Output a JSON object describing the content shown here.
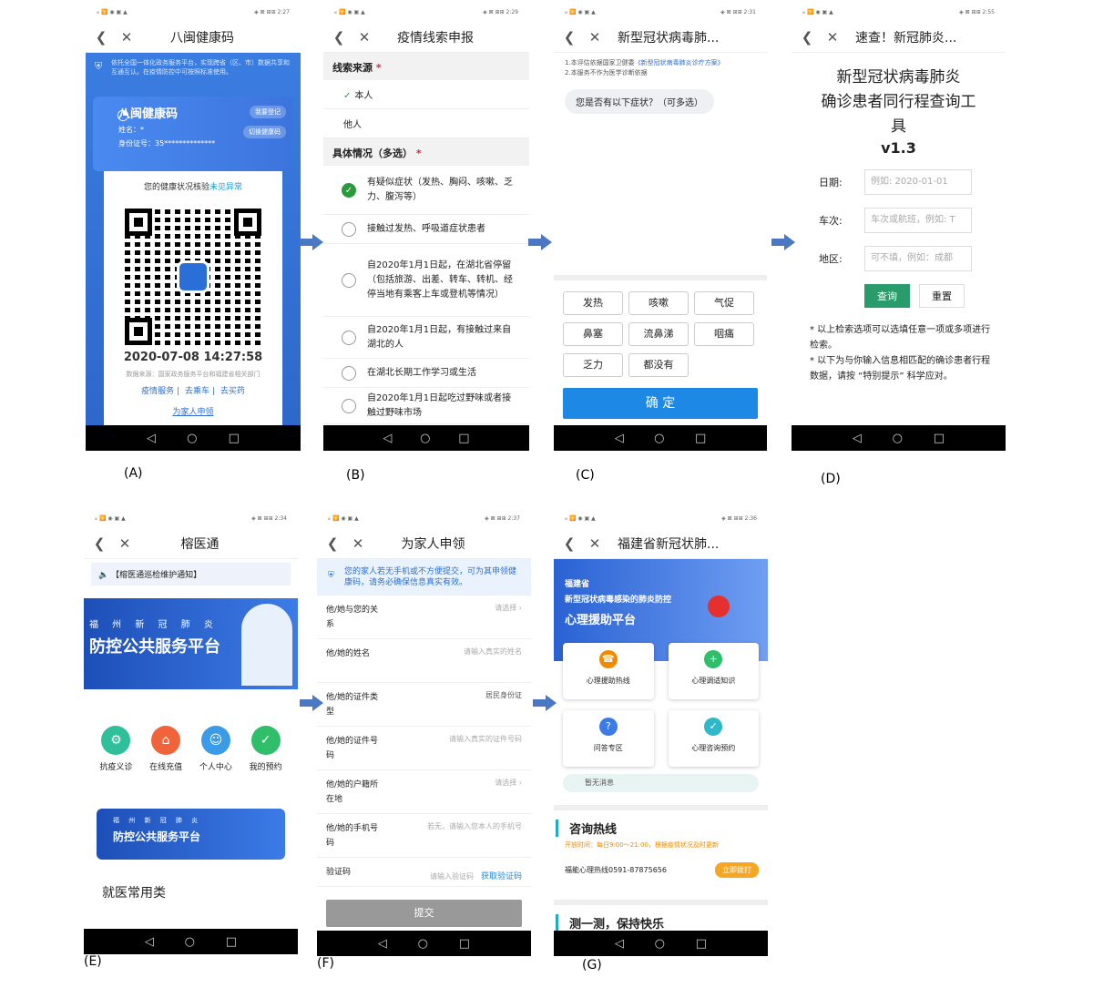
{
  "panels": {
    "A": {
      "caption": "(A)",
      "status_left": "ᵢₗₗ 🛜 ◉ ▣ ▲",
      "status_right": "◈ ⊠ ⊞⊞ 2:27",
      "title": "八闽健康码",
      "notice": "依托全国一体化政务服务平台，实现跨省（区、市）数据共享和互通互认。在疫情防控中可按照标准使用。",
      "card_logo": "八闽健康码",
      "name_label": "姓名：*",
      "id_label": "身份证号：35**************",
      "btn_1": "我要登记",
      "btn_2": "切换健康码",
      "status_prefix": "您的健康状况核验",
      "status_value": "未见异常",
      "time": "2020-07-08 14:27:58",
      "source": "数据来源：国家政务服务平台和福建省相关部门",
      "link_1": "疫情服务",
      "link_2": "去乘车",
      "link_3": "去买药",
      "family": "为家人申领"
    },
    "B": {
      "caption": "(B)",
      "status_left": "ᵢₗₗ 🛜 ◉ ▣ ▲",
      "status_right": "◈ ⊠ ⊞⊞ 2:29",
      "title": "疫情线索申报",
      "section_1": "线索来源",
      "opt_self": "本人",
      "opt_other": "他人",
      "section_2": "具体情况（多选）",
      "items": [
        "有疑似症状（发热、胸闷、咳嗽、乏力、腹泻等）",
        "接触过发热、呼吸道症状患者",
        "自2020年1月1日起，在湖北省停留（包括旅游、出差、转车、转机、经停当地有乘客上车或登机等情况）",
        "自2020年1月1日起，有接触过来自湖北的人",
        "在湖北长期工作学习或生活",
        "自2020年1月1日起吃过野味或者接触过野味市场"
      ]
    },
    "C": {
      "caption": "(C)",
      "status_left": "ᵢₗₗ 🛜 ◉ ▣ ▲",
      "status_right": "◈ ⊠ ⊞⊞ 2:31",
      "title": "新型冠状病毒肺...",
      "info_1_prefix": "1.本评估依据国家卫健委",
      "info_1_link": "《新型冠状病毒肺炎诊疗方案》",
      "info_2": "2.本服务不作为医学诊断依据",
      "question": "您是否有以下症状？（可多选）",
      "chips": [
        "发热",
        "咳嗽",
        "气促",
        "鼻塞",
        "流鼻涕",
        "咽痛",
        "乏力",
        "都没有"
      ],
      "confirm": "确 定"
    },
    "D": {
      "caption": "(D)",
      "status_left": "ᵢₗₗ 🛜 ◉ ▣ ▲",
      "status_right": "◈ ⊠ ⊞⊞ 2:55",
      "title": "速查！新冠肺炎...",
      "heading_1": "新型冠状病毒肺炎",
      "heading_2": "确诊患者同行程查询工",
      "heading_3": "具",
      "version": "v1.3",
      "date_label": "日期:",
      "date_ph": "例如: 2020-01-01",
      "train_label": "车次:",
      "train_ph": "车次或航班，例如: T",
      "area_label": "地区:",
      "area_ph": "可不填，例如：成都",
      "query": "查询",
      "reset": "重置",
      "note_1": "* 以上检索选项可以选填任意一项或多项进行检索。",
      "note_2": "* 以下为与你输入信息相匹配的确诊患者行程数据，请按 “特别提示” 科学应对。"
    },
    "E": {
      "caption": "(E)",
      "status_left": "ᵢₗₗ 🛜 ◉ ▣ ▲",
      "status_right": "◈ ⊠ ⊞⊞ 2:34",
      "title": "榕医通",
      "notice": "【榕医通巡检维护通知】",
      "banner_small": "福 州 新 冠 肺 炎",
      "banner_large": "防控公共服务平台",
      "icons": [
        "抗疫义诊",
        "在线充值",
        "个人中心",
        "我的预约"
      ],
      "banner2_small": "福 州 新 冠 肺 炎",
      "banner2_large": "防控公共服务平台",
      "section": "就医常用类"
    },
    "F": {
      "caption": "(F)",
      "status_left": "ᵢₗₗ 🛜 ◉ ▣ ▲",
      "status_right": "◈ ⊠ ⊞⊞ 2:37",
      "title": "为家人申领",
      "notice": "您的家人若无手机或不方便提交，可为其申领健康码，请务必确保信息真实有效。",
      "rows": [
        {
          "label": "他/她与您的关系",
          "value": "请选择 ›"
        },
        {
          "label": "他/她的姓名",
          "value": "请输入真实的姓名"
        },
        {
          "label": "他/她的证件类型",
          "value": "居民身份证"
        },
        {
          "label": "他/她的证件号码",
          "value": "请输入真实的证件号码"
        },
        {
          "label": "他/她的户籍所在地",
          "value": "请选择 ›"
        },
        {
          "label": "他/她的手机号码",
          "value": "若无，请输入您本人的手机号"
        }
      ],
      "code_label": "验证码",
      "code_ph": "请输入验证码",
      "code_btn": "获取验证码",
      "submit": "提交"
    },
    "G": {
      "caption": "(G)",
      "status_left": "ᵢₗₗ 🛜 ◉ ▣ ▲",
      "status_right": "◈ ⊠ ⊞⊞ 2:36",
      "title": "福建省新冠状肺...",
      "hero_1": "福建省",
      "hero_2": "新型冠状病毒感染的肺炎防控",
      "hero_3": "心理援助平台",
      "cards": [
        "心理援助热线",
        "心理调适知识",
        "问答专区",
        "心理咨询预约"
      ],
      "msg": "暂无消息",
      "hotline_title": "咨询热线",
      "hours": "开放时间：每日9:00～21:00，根据疫情状况及时更新",
      "hotline": "福能心理热线0591-87875656",
      "call": "立即拨打",
      "test_title": "测一测，保持快乐"
    }
  },
  "nav_icons": [
    "back-icon",
    "close-icon"
  ],
  "android_icons": [
    "back-triangle-icon",
    "home-circle-icon",
    "recent-square-icon"
  ],
  "colors": {
    "blue": "#2e66c9",
    "green": "#2a9b3a",
    "accent": "#1e88e5",
    "arrow": "#4a78c2"
  }
}
